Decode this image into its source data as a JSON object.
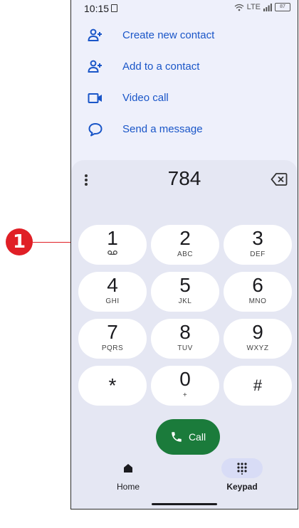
{
  "callout": {
    "number": "1"
  },
  "status_bar": {
    "time": "10:15",
    "network_label": "LTE",
    "battery_level": "87"
  },
  "menu": [
    {
      "label": "Create new contact",
      "icon": "add-person-icon"
    },
    {
      "label": "Add to a contact",
      "icon": "add-person-icon"
    },
    {
      "label": "Video call",
      "icon": "video-camera-icon"
    },
    {
      "label": "Send a message",
      "icon": "message-bubble-icon"
    }
  ],
  "dialer": {
    "number": "784"
  },
  "keys": [
    {
      "digit": "1",
      "letters": ""
    },
    {
      "digit": "2",
      "letters": "ABC"
    },
    {
      "digit": "3",
      "letters": "DEF"
    },
    {
      "digit": "4",
      "letters": "GHI"
    },
    {
      "digit": "5",
      "letters": "JKL"
    },
    {
      "digit": "6",
      "letters": "MNO"
    },
    {
      "digit": "7",
      "letters": "PQRS"
    },
    {
      "digit": "8",
      "letters": "TUV"
    },
    {
      "digit": "9",
      "letters": "WXYZ"
    },
    {
      "digit": "*",
      "letters": ""
    },
    {
      "digit": "0",
      "letters": "+"
    },
    {
      "digit": "#",
      "letters": ""
    }
  ],
  "call_button": {
    "label": "Call"
  },
  "nav": {
    "home_label": "Home",
    "keypad_label": "Keypad",
    "active": "Keypad"
  },
  "colors": {
    "accent": "#1a56c8",
    "call_green": "#1b7b3b",
    "callout_red": "#e01f26",
    "background": "#eef0fb"
  }
}
